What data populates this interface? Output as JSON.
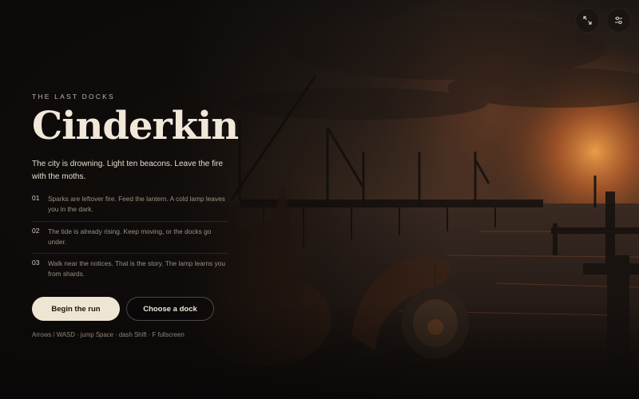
{
  "game": {
    "eyebrow": "THE LAST DOCKS",
    "title": "Cinderkin",
    "tagline": "The city is drowning. Light ten beacons. Leave the fire with the moths."
  },
  "rules": [
    {
      "number": "01",
      "text": "Sparks are leftover fire. Feed the lantern. A cold lamp leaves you in the dark."
    },
    {
      "number": "02",
      "text": "The tide is already rising. Keep moving, or the docks go under."
    },
    {
      "number": "03",
      "text": "Walk near the notices. That is the story. The lamp learns you from shards."
    }
  ],
  "actions": {
    "primary_label": "Begin the run",
    "secondary_label": "Choose a dock"
  },
  "controls_hint": "Arrows / WASD · jump Space · dash Shift · F fullscreen",
  "top_controls": {
    "fullscreen_icon": "expand-icon",
    "settings_icon": "sliders-icon"
  },
  "colors": {
    "background": "#0f0c0a",
    "title": "#f1e8da",
    "primary_button": "#efe5d5",
    "sunset_glow": "#e07a2e"
  }
}
